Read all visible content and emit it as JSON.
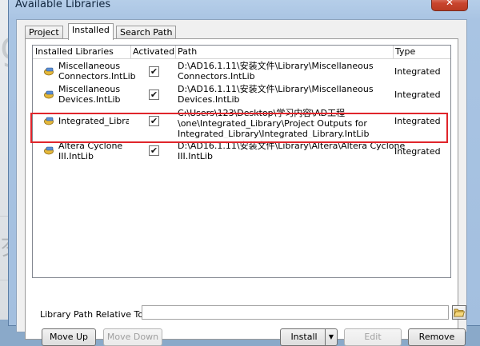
{
  "background": {
    "glyph_top": "g",
    "glyph_bottom": "歹"
  },
  "window": {
    "title": "Available Libraries",
    "close_label": "✕"
  },
  "tabs": [
    {
      "label": "Project",
      "active": false
    },
    {
      "label": "Installed",
      "active": true
    },
    {
      "label": "Search Path",
      "active": false
    }
  ],
  "columns": [
    "Installed Libraries",
    "Activated",
    "Path",
    "Type"
  ],
  "rows": [
    {
      "name": "Miscellaneous\nConnectors.IntLib",
      "activated": "✔",
      "path": "D:\\AD16.1.11\\安装文件\\Library\\Miscellaneous\nConnectors.IntLib",
      "type": "Integrated"
    },
    {
      "name": "Miscellaneous\nDevices.IntLib",
      "activated": "✔",
      "path": "D:\\AD16.1.11\\安装文件\\Library\\Miscellaneous\nDevices.IntLib",
      "type": "Integrated"
    },
    {
      "name": "Integrated_Library",
      "activated": "✔",
      "path": "C:\\Users\\123\\Desktop\\学习内容\\AD工程\n\\one\\Integrated_Library\\Project Outputs for\nIntegrated_Library\\Integrated_Library.IntLib",
      "type": "Integrated"
    },
    {
      "name": "Altera Cyclone\nIII.IntLib",
      "activated": "✔",
      "path": "D:\\AD16.1.11\\安装文件\\Library\\Altera\\Altera Cyclone\nIII.IntLib",
      "type": "Integrated"
    }
  ],
  "relative_path": {
    "label": "Library Path Relative To:",
    "value": ""
  },
  "buttons": {
    "move_up": "Move Up",
    "move_down": "Move Down",
    "install": "Install",
    "install_arrow": "▼",
    "edit": "Edit",
    "remove": "Remove"
  },
  "colors": {
    "highlight": "#e0252b",
    "title_bar": "#a9c4e3"
  }
}
